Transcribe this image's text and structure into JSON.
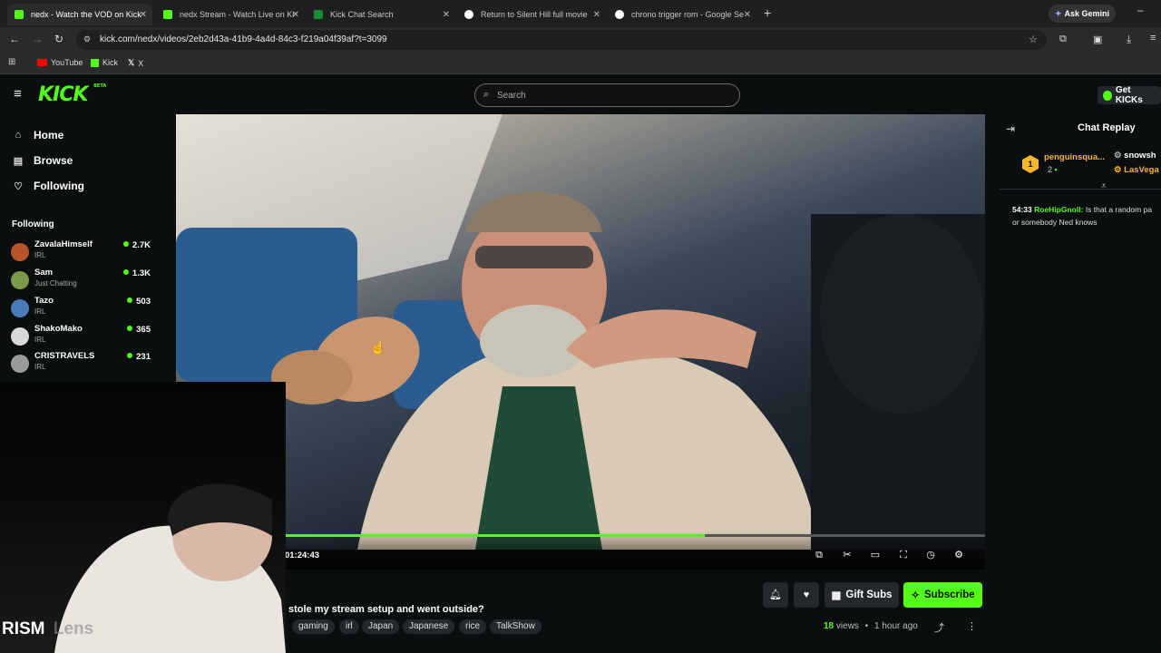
{
  "browser": {
    "tabs": [
      {
        "label": "nedx - Watch the VOD on Kick",
        "active": true
      },
      {
        "label": "nedx Stream - Watch Live on Ki",
        "active": false
      },
      {
        "label": "Kick Chat Search",
        "active": false
      },
      {
        "label": "Return to Silent Hill full movie",
        "active": false
      },
      {
        "label": "chrono trigger rom - Google Se",
        "active": false
      }
    ],
    "new_tab": "+",
    "gemini": "Ask Gemini",
    "url": "kick.com/nedx/videos/2eb2d43a-41b9-4a4d-84c3-f219a04f39af?t=3099",
    "bookmarks": [
      "YouTube",
      "Kick",
      "X"
    ]
  },
  "header": {
    "logo": "KICK",
    "logo_badge": "BETA",
    "search_placeholder": "Search",
    "get_kicks": "Get KICKs"
  },
  "sidebar": {
    "nav": [
      {
        "label": "Home",
        "icon": "home-icon"
      },
      {
        "label": "Browse",
        "icon": "browse-icon"
      },
      {
        "label": "Following",
        "icon": "heart-icon"
      }
    ],
    "following_title": "Following",
    "following": [
      {
        "name": "ZavalaHimself",
        "category": "IRL",
        "viewers": "2.7K",
        "color": "#b8542a"
      },
      {
        "name": "Sam",
        "category": "Just Chatting",
        "viewers": "1.3K",
        "color": "#7a9a4a"
      },
      {
        "name": "Tazo",
        "category": "IRL",
        "viewers": "503",
        "color": "#4a7ab8"
      },
      {
        "name": "ShakoMako",
        "category": "IRL",
        "viewers": "365",
        "color": "#d8d8d8"
      },
      {
        "name": "CRISTRAVELS",
        "category": "IRL",
        "viewers": "231",
        "color": "#9a9a9a"
      }
    ]
  },
  "player": {
    "time": "01:24:43",
    "progress_fraction": 0.6
  },
  "video_info": {
    "title": "stole my stream setup and went outside?",
    "tags": [
      "gaming",
      "irl",
      "Japan",
      "Japanese",
      "rice",
      "TalkShow"
    ],
    "views_count": "18",
    "views_label": "views",
    "separator": "•",
    "ago": "1 hour ago",
    "gift_subs": "Gift Subs",
    "subscribe": "Subscribe"
  },
  "chat": {
    "title": "Chat Replay",
    "leaderboard": [
      {
        "rank": "1",
        "name": "penguinsqua...",
        "count": "2"
      },
      {
        "name": "snowsh"
      },
      {
        "name": "LasVega"
      }
    ],
    "messages": [
      {
        "time": "54:33",
        "user": "RoeHipGnoll:",
        "text": "Is that a random pa or somebody Ned knows"
      }
    ]
  },
  "webcam": {
    "overlay_text": "RISM",
    "overlay_text_faded": "Lens"
  },
  "colors": {
    "accent": "#53fc18",
    "bg": "#0b0e0f",
    "panel": "#24272c"
  }
}
